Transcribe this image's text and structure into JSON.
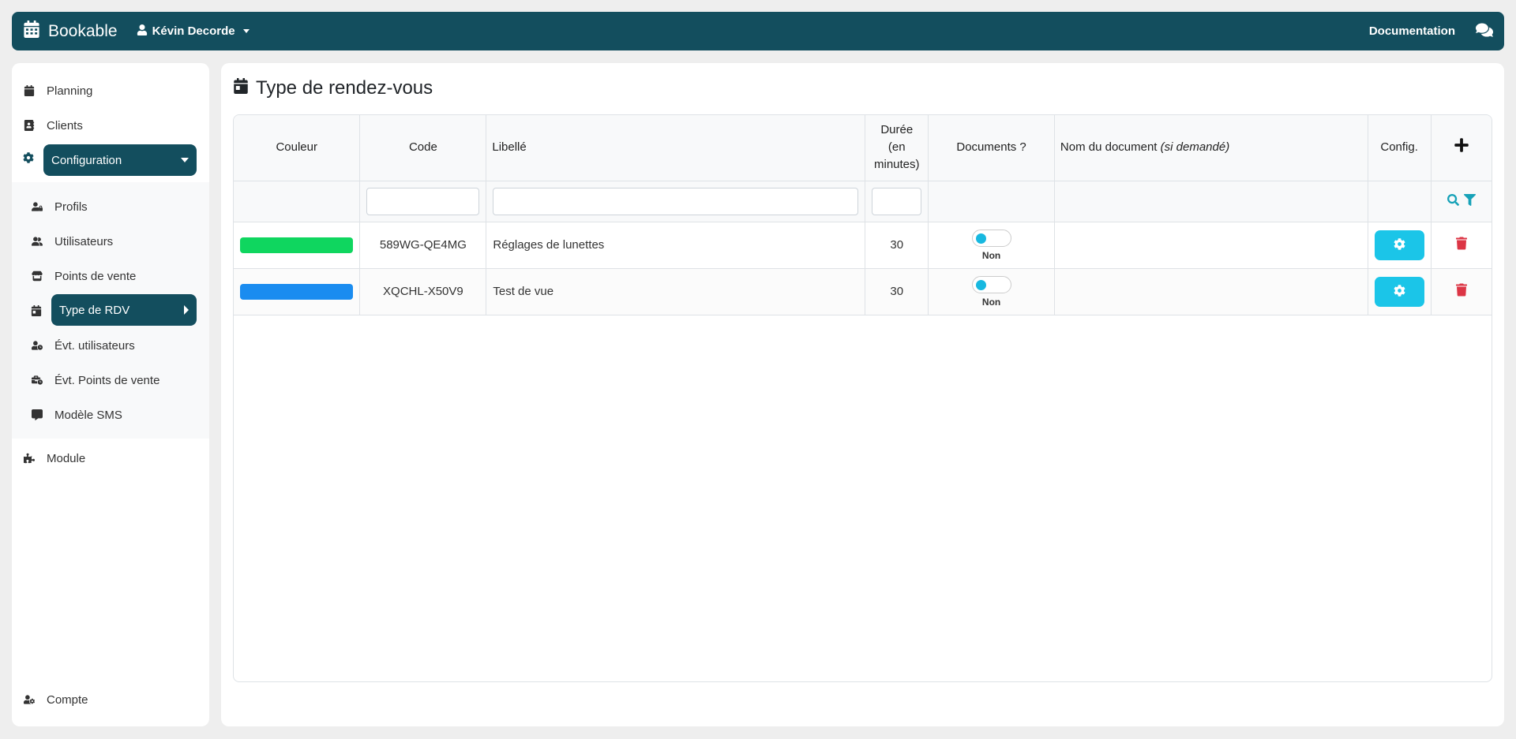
{
  "navbar": {
    "brand": "Bookable",
    "user": "Kévin Decorde",
    "documentation": "Documentation",
    "chat_icon": "comments-icon"
  },
  "sidebar": {
    "planning": "Planning",
    "clients": "Clients",
    "configuration": "Configuration",
    "submenu": {
      "profils": "Profils",
      "utilisateurs": "Utilisateurs",
      "points_de_vente": "Points de vente",
      "type_rdv": "Type de RDV",
      "evt_utilisateurs": "Évt. utilisateurs",
      "evt_points_de_vente": "Évt. Points de vente",
      "modele_sms": "Modèle SMS"
    },
    "module": "Module",
    "compte": "Compte"
  },
  "main": {
    "title": "Type de rendez-vous",
    "columns": {
      "couleur": "Couleur",
      "code": "Code",
      "libelle": "Libellé",
      "duree_1": "Durée",
      "duree_2": "(en",
      "duree_3": "minutes)",
      "documents": "Documents ?",
      "nom_document": "Nom du document",
      "nom_document_hint": "(si demandé)",
      "config": "Config."
    },
    "filters": {
      "code": "",
      "libelle": "",
      "duree": ""
    },
    "rows": [
      {
        "color": "#0fd65f",
        "code": "589WG-QE4MG",
        "libelle": "Réglages de lunettes",
        "duree": "30",
        "documents": "Non",
        "nom_document": ""
      },
      {
        "color": "#1a8cf0",
        "code": "XQCHL-X50V9",
        "libelle": "Test de vue",
        "duree": "30",
        "documents": "Non",
        "nom_document": ""
      }
    ]
  },
  "colors": {
    "primary": "#134e5e",
    "info": "#1bc5e8",
    "danger": "#dc3545",
    "background": "#eeeeee"
  }
}
